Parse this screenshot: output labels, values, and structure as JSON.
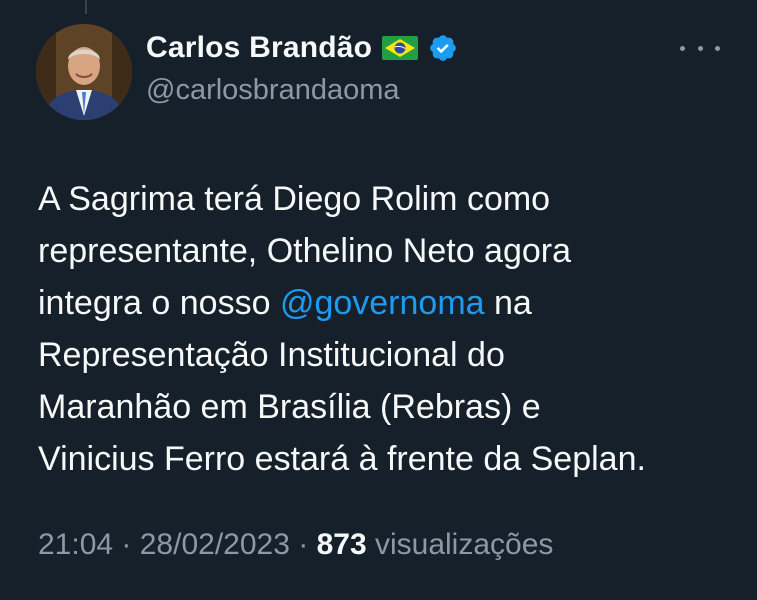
{
  "author": {
    "display_name": "Carlos Brandão",
    "handle": "@carlosbrandaoma",
    "flag_icon": "brazil-flag-icon",
    "verified_icon": "verified-badge-icon"
  },
  "more_icon": "more-options-icon",
  "tweet": {
    "line1": "A Sagrima terá Diego Rolim como",
    "line2": "representante, Othelino Neto agora",
    "line3_before": "integra o nosso ",
    "mention": "@governoma",
    "line3_after": " na",
    "line4": "Representação Institucional do",
    "line5": "Maranhão em Brasília (Rebras) e",
    "line6": "Vinicius Ferro estará à frente da Seplan."
  },
  "meta": {
    "time": "21:04",
    "separator1": " · ",
    "date": "28/02/2023",
    "separator2": " · ",
    "views_count": "873",
    "views_label": " visualizações"
  },
  "colors": {
    "background": "#15202b",
    "text": "#f7f9f9",
    "secondary": "#8b98a5",
    "link": "#1d9bf0"
  }
}
